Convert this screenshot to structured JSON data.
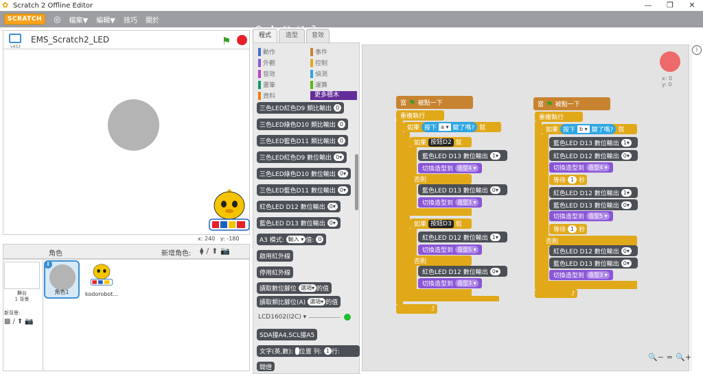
{
  "window": {
    "title": "Scratch 2 Offline Editor",
    "minimize": "—",
    "maximize": "❐",
    "close": "✕"
  },
  "menu": {
    "logo": "SCRATCH",
    "globe": "◎",
    "file": "檔案▼",
    "edit": "編輯▼",
    "tips": "技巧",
    "about": "關於"
  },
  "tools": {
    "duplicate": "⚲",
    "delete": "✚",
    "grow": "⤧",
    "shrink": "⤨",
    "help": "?"
  },
  "stage": {
    "version": "v453",
    "project_name": "EMS_Scratch2_LED",
    "flag": "⚑",
    "x_label": "x:",
    "x_value": "240",
    "y_label": "y:",
    "y_value": "-180"
  },
  "sprites": {
    "header": "角色",
    "new_sprite": "新增角色:",
    "new_icons": [
      "⧫",
      "/",
      "⬆",
      "📷"
    ],
    "stage_label": "舞台",
    "stage_count": "1 背景",
    "new_backdrop": "新背景:",
    "backdrop_icons": [
      "▩",
      "/",
      "⬆",
      "📷"
    ],
    "info": "i",
    "items": [
      {
        "name": "角色1"
      },
      {
        "name": "kodorobot..."
      }
    ]
  },
  "tabs": [
    "程式",
    "造型",
    "音效"
  ],
  "categories": {
    "motion": "動作",
    "looks": "外觀",
    "sound": "音效",
    "pen": "畫筆",
    "data": "資料",
    "events": "事件",
    "control": "控制",
    "sensing": "偵測",
    "operators": "運算",
    "more": "更多積木",
    "colors": {
      "motion": "#4a6cd4",
      "looks": "#8a55d7",
      "sound": "#bb42c3",
      "pen": "#0e9a6c",
      "data": "#ee7d16",
      "events": "#c88330",
      "control": "#e1a91a",
      "sensing": "#2ca5e2",
      "operators": "#5cb712"
    }
  },
  "palette_blocks": [
    {
      "text": "三色LED紅色D9 類比輸出",
      "pill": "0"
    },
    {
      "text": "三色LED綠色D10 類比輸出",
      "pill": "0"
    },
    {
      "text": "三色LED藍色D11 類比輸出",
      "pill": "0"
    },
    {
      "text": "三色LED紅色D9 數位輸出",
      "pill": "0▾"
    },
    {
      "text": "三色LED綠色D10 數位輸出",
      "pill": "0▾"
    },
    {
      "text": "三色LED藍色D11 數位輸出",
      "pill": "0▾"
    },
    {
      "text": "紅色LED D12 數位輸出",
      "pill": "0▾"
    },
    {
      "text": "藍色LED D13 數位輸出",
      "pill": "0▾"
    },
    {
      "text": "A3 模式: ",
      "pill": "輸入 ▾",
      "suffix": " 值: ",
      "pill2": "0"
    },
    {
      "text": "啟用紅外線",
      "pill": ""
    },
    {
      "text": "停用紅外線",
      "pill": ""
    },
    {
      "text": "讀取數位腳位",
      "pill": "選項▾",
      "suffix": "的值"
    },
    {
      "text": "讀取類比腳位(A)",
      "pill": "選項▾",
      "suffix": "的值"
    },
    {
      "text": "SDA接A4,SCL接A5",
      "pill": ""
    },
    {
      "text": "文字(英,數): ",
      "pill": " ",
      "suffix": "位置 列: ",
      "pill2": "1",
      "suffix2": "行: "
    },
    {
      "text": "開燈",
      "pill": ""
    }
  ],
  "lcd_section": "LCD1602(I2C) ▾",
  "script": {
    "sprite_xy": {
      "x": "x: 0",
      "y": "y: 0"
    },
    "zoom": {
      "out": "🔍−",
      "reset": "=",
      "in": "🔍+"
    },
    "when": "當",
    "clicked": "被點一下",
    "forever": "重複執行",
    "if": "如果",
    "then": "就",
    "else": "否則",
    "key_pressed": "按下",
    "key_suffix": "鍵了嗎?",
    "key_a": "a ▾",
    "key_b": "b ▾",
    "btn_d2": "按鈕D2",
    "btn_d3": "按鈕D3",
    "blue13": "藍色LED D13 數位輸出",
    "red12": "紅色LED D12 數位輸出",
    "switch_costume": "切換造型到",
    "cost3": "造型3 ▾",
    "cost4": "造型4 ▾",
    "cost5": "造型5 ▾",
    "wait": "等待",
    "sec": "秒",
    "one": "1",
    "v1": "1▾",
    "v0": "0▾",
    "end_arrow": "⮥"
  }
}
